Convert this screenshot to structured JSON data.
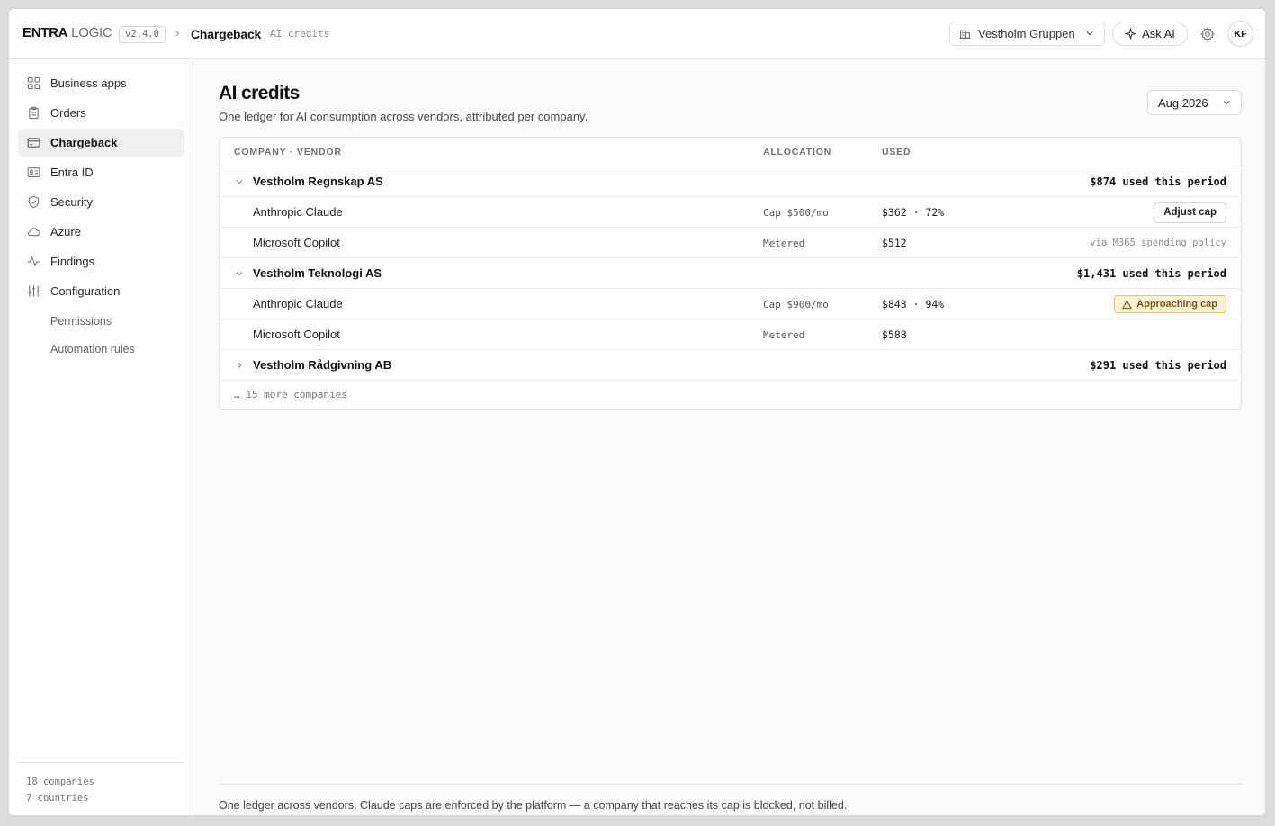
{
  "header": {
    "brand_primary": "ENTRA",
    "brand_secondary": "LOGIC",
    "version": "v2.4.0",
    "breadcrumb_separator": "›",
    "page": "Chargeback",
    "subpage": "AI credits",
    "tenant": "Vestholm Gruppen",
    "ask_ai": "Ask AI",
    "avatar_initials": "KF"
  },
  "sidebar": {
    "items": [
      {
        "label": "Business apps",
        "icon": "grid-icon"
      },
      {
        "label": "Orders",
        "icon": "clipboard-icon"
      },
      {
        "label": "Chargeback",
        "icon": "credit-card-icon",
        "active": true
      },
      {
        "label": "Entra ID",
        "icon": "id-card-icon"
      },
      {
        "label": "Security",
        "icon": "shield-icon"
      },
      {
        "label": "Azure",
        "icon": "cloud-icon"
      },
      {
        "label": "Findings",
        "icon": "activity-icon"
      },
      {
        "label": "Configuration",
        "icon": "sliders-icon"
      }
    ],
    "subitems": [
      "Permissions",
      "Automation rules"
    ],
    "footer": {
      "companies": "18 companies",
      "countries": "7 countries"
    }
  },
  "main": {
    "title": "AI credits",
    "subtitle": "One ledger for AI consumption across vendors, attributed per company.",
    "period": "Aug 2026",
    "columns": [
      "COMPANY · VENDOR",
      "ALLOCATION",
      "USED"
    ],
    "companies": [
      {
        "name": "Vestholm Regnskap AS",
        "expanded": true,
        "total": "$874 used this period",
        "vendors": [
          {
            "name": "Anthropic Claude",
            "allocation": "Cap $500/mo",
            "used": "$362 · 72%",
            "action": "Adjust cap"
          },
          {
            "name": "Microsoft Copilot",
            "allocation": "Metered",
            "used": "$512",
            "note": "via M365 spending policy"
          }
        ]
      },
      {
        "name": "Vestholm Teknologi AS",
        "expanded": true,
        "total": "$1,431 used this period",
        "vendors": [
          {
            "name": "Anthropic Claude",
            "allocation": "Cap $900/mo",
            "used": "$843 · 94%",
            "badge": "Approaching cap"
          },
          {
            "name": "Microsoft Copilot",
            "allocation": "Metered",
            "used": "$588"
          }
        ]
      },
      {
        "name": "Vestholm Rådgivning AB",
        "expanded": false,
        "total": "$291 used this period"
      }
    ],
    "more": "… 15 more companies",
    "footer_note": "One ledger across vendors. Claude caps are enforced by the platform — a company that reaches its cap is blocked, not billed."
  },
  "colors": {
    "warning_bg": "#fdf3d6",
    "warning_border": "#e6c36a",
    "warning_text": "#7a5510",
    "active_nav": "#f0f0f0"
  }
}
